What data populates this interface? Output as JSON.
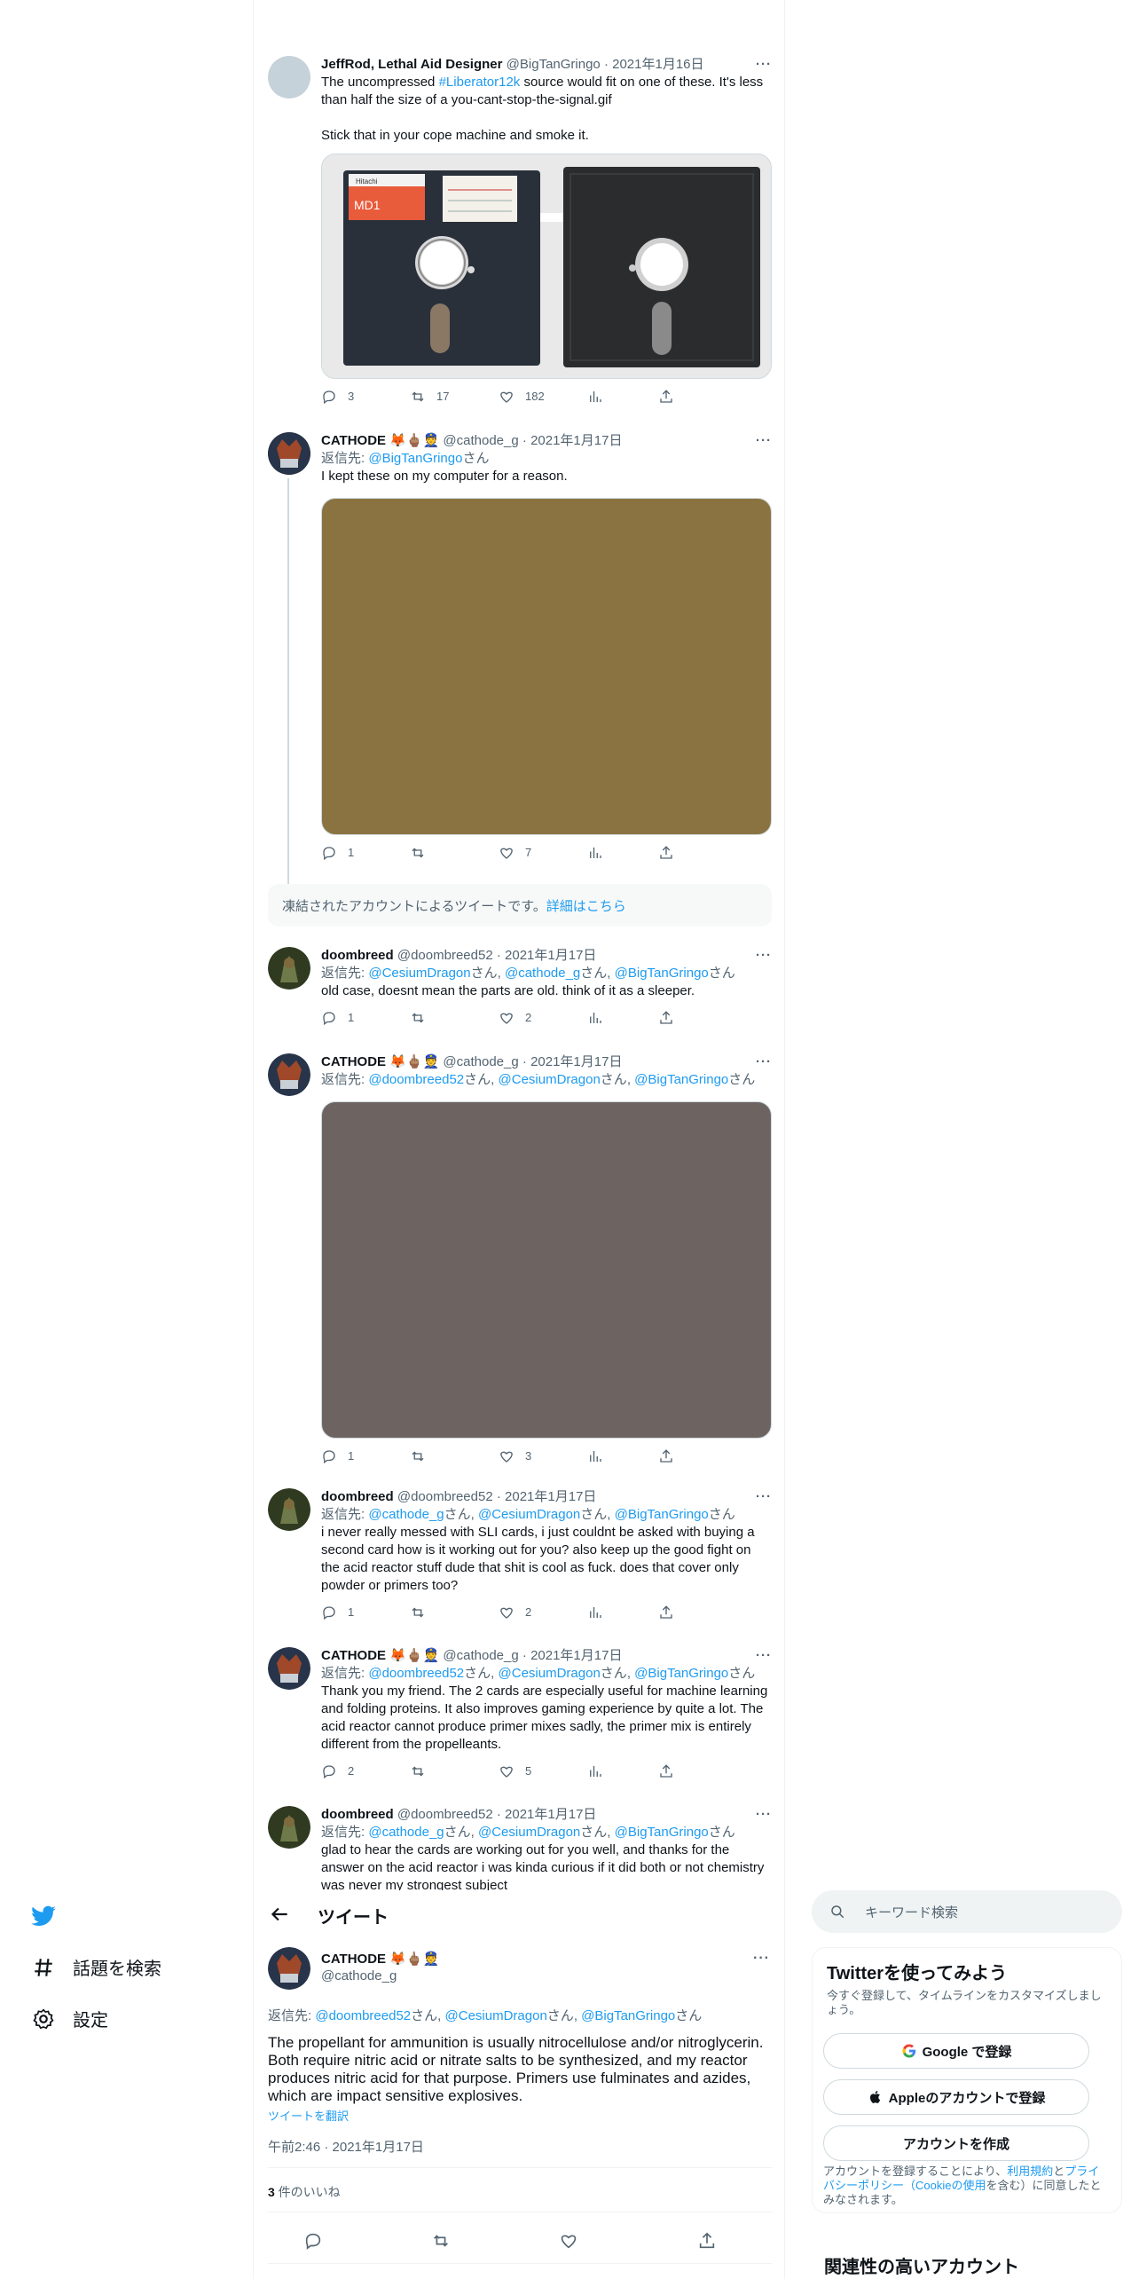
{
  "timeline": {
    "tweets": [
      {
        "name": "JeffRod, Lethal Aid Designer",
        "handle": "@BigTanGringo",
        "date": "2021年1月16日",
        "text_before": "The uncompressed ",
        "hashtag": "#Liberator12k",
        "text_after": " source would fit on one of these. It's less than half the size of a you-cant-stop-the-signal.gif\n\nStick that in your cope machine and smoke it.",
        "floppy_label_1": "MD1",
        "floppy_label_2": "Hitachi",
        "stats": {
          "replies": "3",
          "retweets": "17",
          "likes": "182"
        }
      },
      {
        "name": "CATHODE 🦊🖕🏽👮",
        "handle": "@cathode_g",
        "date": "2021年1月17日",
        "reply_prefix": "返信先: ",
        "reply_to": [
          "@BigTanGringo"
        ],
        "reply_suffix": "さん",
        "text": "I kept these on my computer for a reason.",
        "media_color": "#8a7340",
        "stats": {
          "replies": "1",
          "retweets": "",
          "likes": "7"
        }
      },
      {
        "name": "doombreed",
        "handle": "@doombreed52",
        "date": "2021年1月17日",
        "reply_prefix": "返信先: ",
        "reply_to": [
          "@CesiumDragon",
          "@cathode_g",
          "@BigTanGringo"
        ],
        "reply_suffix": "さん",
        "text": "old case, doesnt mean the parts are old. think of it as a sleeper.",
        "stats": {
          "replies": "1",
          "retweets": "",
          "likes": "2"
        }
      },
      {
        "name": "CATHODE 🦊🖕🏽👮",
        "handle": "@cathode_g",
        "date": "2021年1月17日",
        "reply_prefix": "返信先: ",
        "reply_to": [
          "@doombreed52",
          "@CesiumDragon",
          "@BigTanGringo"
        ],
        "reply_suffix": "さん",
        "media_color": "#6d6462",
        "stats": {
          "replies": "1",
          "retweets": "",
          "likes": "3"
        }
      },
      {
        "name": "doombreed",
        "handle": "@doombreed52",
        "date": "2021年1月17日",
        "reply_prefix": "返信先: ",
        "reply_to": [
          "@cathode_g",
          "@CesiumDragon",
          "@BigTanGringo"
        ],
        "reply_suffix": "さん",
        "text": "i never really messed with SLI cards, i just couldnt be asked with buying a second card how is it working out for you? also keep up the good fight on the acid reactor stuff dude that shit is cool as fuck. does that cover only powder or primers too?",
        "stats": {
          "replies": "1",
          "retweets": "",
          "likes": "2"
        }
      },
      {
        "name": "CATHODE 🦊🖕🏽👮",
        "handle": "@cathode_g",
        "date": "2021年1月17日",
        "reply_prefix": "返信先: ",
        "reply_to": [
          "@doombreed52",
          "@CesiumDragon",
          "@BigTanGringo"
        ],
        "reply_suffix": "さん",
        "text": "Thank you my friend. The 2 cards are especially useful for machine learning and folding proteins. It also improves gaming experience by quite a lot. The acid reactor cannot produce primer mixes sadly, the primer mix is entirely different from the propelleants.",
        "stats": {
          "replies": "2",
          "retweets": "",
          "likes": "5"
        }
      },
      {
        "name": "doombreed",
        "handle": "@doombreed52",
        "date": "2021年1月17日",
        "reply_prefix": "返信先: ",
        "reply_to": [
          "@cathode_g",
          "@CesiumDragon",
          "@BigTanGringo"
        ],
        "reply_suffix": "さん",
        "text": "glad to hear the cards are working out for you well, and thanks for the answer on the acid reactor i was kinda curious if it did both or not chemistry was never my strongest subject"
      }
    ],
    "suspended": {
      "text": "凍結されたアカウントによるツイートです。",
      "link": "詳細はこちら"
    }
  },
  "nav": {
    "explore": "話題を検索",
    "settings": "設定"
  },
  "detail": {
    "header_title": "ツイート",
    "name": "CATHODE 🦊🖕🏽👮",
    "handle": "@cathode_g",
    "reply_prefix": "返信先: ",
    "reply_to": [
      "@doombreed52",
      "@CesiumDragon",
      "@BigTanGringo"
    ],
    "reply_suffix": "さん",
    "text": "The propellant for ammunition is usually nitrocellulose and/or nitroglycerin. Both require nitric acid or nitrate salts to be synthesized, and my reactor produces nitric acid for that purpose. Primers use fulminates and azides, which are impact sensitive explosives.",
    "translate": "ツイートを翻訳",
    "timestamp": "午前2:46 · 2021年1月17日",
    "likes_count": "3",
    "likes_label": " 件のいいね"
  },
  "sidebar": {
    "search_placeholder": "キーワード検索",
    "signup_title": "Twitterを使ってみよう",
    "signup_sub": "今すぐ登録して、タイムラインをカスタマイズしましょう。",
    "google": "Google で登録",
    "apple": "Appleのアカウントで登録",
    "create": "アカウントを作成",
    "legal_1": "アカウントを登録することにより、",
    "legal_terms": "利用規約",
    "legal_and": "と",
    "legal_privacy": "プライバシーポリシー",
    "legal_cookie": "（Cookieの使用",
    "legal_2": "を含む）に同意したとみなされます。",
    "related_title": "関連性の高いアカウント"
  }
}
